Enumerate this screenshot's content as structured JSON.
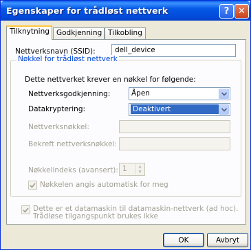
{
  "window": {
    "title": "Egenskaper for trådløst nettverk",
    "help_label": "?",
    "close_label": "✕"
  },
  "tabs": [
    {
      "label": "Tilknytning",
      "active": true
    },
    {
      "label": "Godkjenning",
      "active": false
    },
    {
      "label": "Tilkobling",
      "active": false
    }
  ],
  "ssid": {
    "label": "Nettverksnavn (SSID):",
    "value": "dell_device"
  },
  "key_group": {
    "title": "Nøkkel for trådløst nettverk",
    "description": "Dette nettverket krever en nøkkel for følgende:",
    "auth_label": "Nettverksgodkjenning:",
    "auth_value": "Åpen",
    "encryption_label": "Datakryptering:",
    "encryption_value": "Deaktivert",
    "network_key_label": "Nettverksnøkkel:",
    "network_key_value": "",
    "confirm_key_label": "Bekreft nettverksnøkkel:",
    "confirm_key_value": "",
    "key_index_label": "Nøkkelindeks (avansert):",
    "key_index_value": "1",
    "auto_key_label": "Nøkkelen angis automatisk for meg",
    "auto_key_checked": true
  },
  "adhoc": {
    "line1": "Dette er et datamaskin til datamaskin-nettverk (ad hoc).",
    "line2": "Trådløse tilgangspunkt brukes ikke",
    "checked": true
  },
  "buttons": {
    "ok": "OK",
    "cancel": "Avbryt"
  },
  "colors": {
    "titlebar": "#0559E6",
    "dialog": "#ECE9D8",
    "selection": "#316AC5",
    "group_title": "#0046D5"
  }
}
